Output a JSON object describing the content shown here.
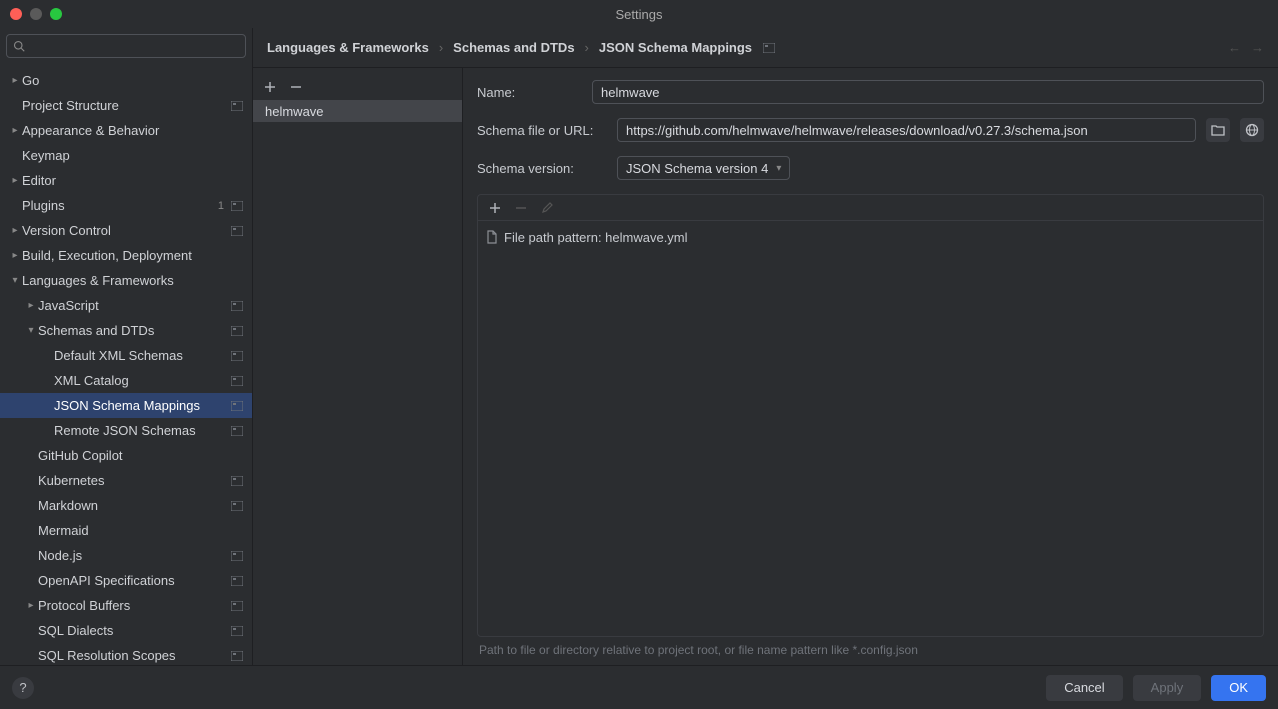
{
  "window": {
    "title": "Settings"
  },
  "search": {
    "placeholder": ""
  },
  "tree": [
    {
      "label": "Go",
      "level": 0,
      "chev": "right",
      "proj": false
    },
    {
      "label": "Project Structure",
      "level": 0,
      "chev": "none",
      "proj": true
    },
    {
      "label": "Appearance & Behavior",
      "level": 0,
      "chev": "right",
      "proj": false
    },
    {
      "label": "Keymap",
      "level": 0,
      "chev": "none",
      "proj": false
    },
    {
      "label": "Editor",
      "level": 0,
      "chev": "right",
      "proj": false
    },
    {
      "label": "Plugins",
      "level": 0,
      "chev": "none",
      "proj": true,
      "badge": "1"
    },
    {
      "label": "Version Control",
      "level": 0,
      "chev": "right",
      "proj": true
    },
    {
      "label": "Build, Execution, Deployment",
      "level": 0,
      "chev": "right",
      "proj": false
    },
    {
      "label": "Languages & Frameworks",
      "level": 0,
      "chev": "down",
      "proj": false
    },
    {
      "label": "JavaScript",
      "level": 1,
      "chev": "right",
      "proj": true
    },
    {
      "label": "Schemas and DTDs",
      "level": 1,
      "chev": "down",
      "proj": true
    },
    {
      "label": "Default XML Schemas",
      "level": 2,
      "chev": "none",
      "proj": true
    },
    {
      "label": "XML Catalog",
      "level": 2,
      "chev": "none",
      "proj": true
    },
    {
      "label": "JSON Schema Mappings",
      "level": 2,
      "chev": "none",
      "proj": true,
      "selected": true
    },
    {
      "label": "Remote JSON Schemas",
      "level": 2,
      "chev": "none",
      "proj": true
    },
    {
      "label": "GitHub Copilot",
      "level": 1,
      "chev": "none",
      "proj": false
    },
    {
      "label": "Kubernetes",
      "level": 1,
      "chev": "none",
      "proj": true
    },
    {
      "label": "Markdown",
      "level": 1,
      "chev": "none",
      "proj": true
    },
    {
      "label": "Mermaid",
      "level": 1,
      "chev": "none",
      "proj": false
    },
    {
      "label": "Node.js",
      "level": 1,
      "chev": "none",
      "proj": true
    },
    {
      "label": "OpenAPI Specifications",
      "level": 1,
      "chev": "none",
      "proj": true
    },
    {
      "label": "Protocol Buffers",
      "level": 1,
      "chev": "right",
      "proj": true
    },
    {
      "label": "SQL Dialects",
      "level": 1,
      "chev": "none",
      "proj": true
    },
    {
      "label": "SQL Resolution Scopes",
      "level": 1,
      "chev": "none",
      "proj": true
    }
  ],
  "breadcrumb": {
    "items": [
      "Languages & Frameworks",
      "Schemas and DTDs",
      "JSON Schema Mappings"
    ]
  },
  "schemas": {
    "items": [
      "helmwave"
    ]
  },
  "form": {
    "name_label": "Name:",
    "name_value": "helmwave",
    "url_label": "Schema file or URL:",
    "url_value": "https://github.com/helmwave/helmwave/releases/download/v0.27.3/schema.json",
    "version_label": "Schema version:",
    "version_value": "JSON Schema version 4",
    "pattern_prefix": "File path pattern: ",
    "pattern_value": "helmwave.yml",
    "hint": "Path to file or directory relative to project root, or file name pattern like *.config.json"
  },
  "buttons": {
    "cancel": "Cancel",
    "apply": "Apply",
    "ok": "OK"
  }
}
